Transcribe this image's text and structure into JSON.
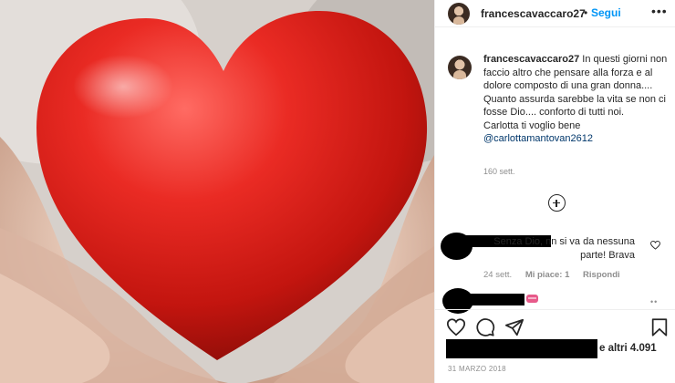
{
  "header": {
    "username": "francescavaccaro27",
    "separator": "•",
    "follow_label": "Segui",
    "more_icon": "ellipsis-icon",
    "more_label": "•••"
  },
  "caption": {
    "username": "francescavaccaro27",
    "text": "In questi giorni non faccio altro che pensare alla forza e al dolore composto di una gran donna.... Quanto assurda sarebbe la vita se non ci fosse Dio.... conforto di tutti noi.",
    "line2": "Carlotta ti voglio bene",
    "mention": "@carlottamantovan2612",
    "time_ago": "160 sett."
  },
  "load_more_icon": "plus-circle-icon",
  "comments": [
    {
      "text": "Senza Dio, nn si va da nessuna parte! Brava",
      "time_ago": "24 sett.",
      "likes": "Mi piace: 1",
      "reply_label": "Rispondi"
    },
    {
      "emoji": "lipstick-emoji"
    }
  ],
  "actions": {
    "like_icon": "heart-icon",
    "comment_icon": "comment-icon",
    "share_icon": "paper-plane-icon",
    "save_icon": "bookmark-icon"
  },
  "likes_summary": "e altri 4.091",
  "post_date": "31 MARZO 2018",
  "colors": {
    "accent": "#0095f6",
    "text": "#262626",
    "muted": "#8e8e8e",
    "heart_red": "#d81e1e"
  }
}
